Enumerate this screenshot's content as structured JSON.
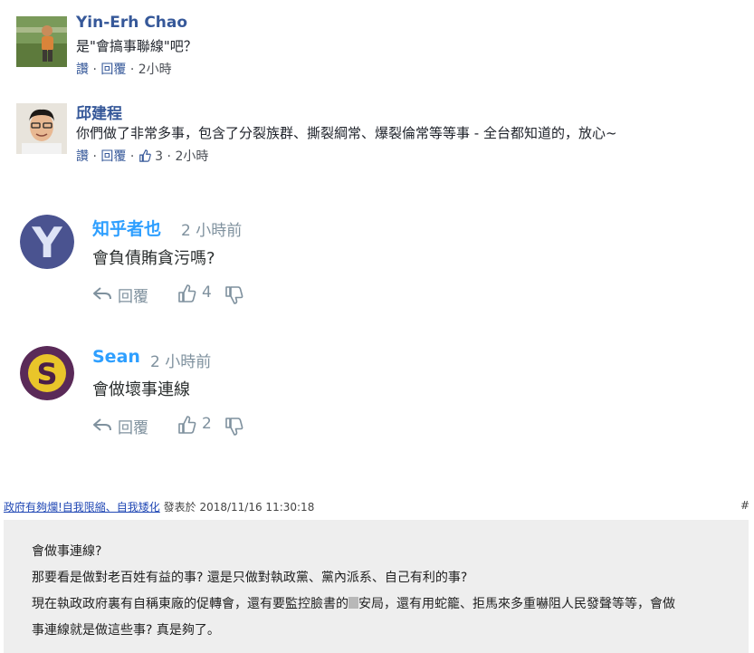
{
  "facebook_comments": [
    {
      "name": "Yin-Erh Chao",
      "text": "是\"會搞事聯線\"吧？",
      "actions": {
        "like": "讚",
        "reply": "回覆",
        "time": "2小時"
      }
    },
    {
      "name": "邱建程",
      "text": "你們做了非常多事，包含了分裂族群、撕裂綱常、爆裂倫常等等事 - 全台都知道的，放心~",
      "actions": {
        "like": "讚",
        "reply": "回覆",
        "like_count": "3",
        "time": "2小時"
      }
    }
  ],
  "disqus_comments": [
    {
      "name": "知乎者也",
      "time": "2 小時前",
      "text": "會負債賄貪污嗎?",
      "avatar_letter": "Y",
      "reply_label": "回覆",
      "upvotes": "4"
    },
    {
      "name": "Sean",
      "time": "2 小時前",
      "text": "會做壞事連線",
      "avatar_letter": "S",
      "reply_label": "回覆",
      "upvotes": "2"
    }
  ],
  "forum_post": {
    "author_link": "政府有夠爛!自我限縮、自我矮化",
    "posted_at": "發表於 2018/11/16 11:30:18",
    "anchor": "#",
    "lines": [
      "會做事連線?",
      "那要看是做對老百姓有益的事? 還是只做對執政黨、黨內派系、自己有利的事?",
      {
        "before": "現在執政政府裏有自稱東廠的促轉會，還有要監控臉書的",
        "after": "安局，還有用蛇籠、拒馬來多重嚇阻人民發聲等等，會做"
      },
      "事連線就是做這些事? 真是夠了。"
    ]
  },
  "colors": {
    "fb_name": "#365899",
    "disqus_name": "#2e9fff",
    "disqus_meta": "#7f919e",
    "forum_bg": "#eeeeee",
    "forum_link": "#2249b5"
  },
  "icons": [
    "thumbs-up-icon",
    "reply-arrow-icon",
    "upvote-icon",
    "downvote-icon"
  ]
}
